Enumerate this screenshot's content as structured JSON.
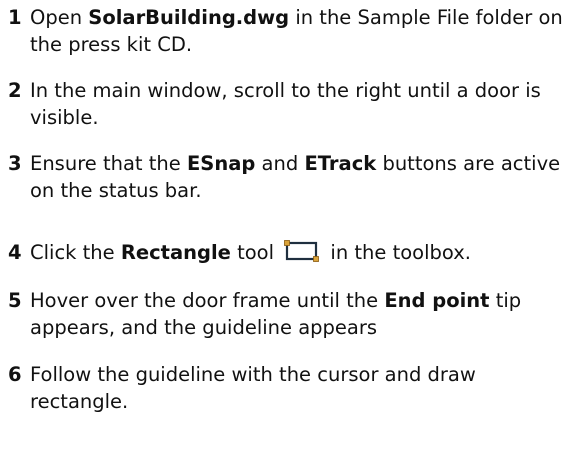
{
  "steps": [
    {
      "number": "1",
      "parts": [
        "Open ",
        "SolarBuilding.dwg",
        " in the Sample File folder on the press kit CD."
      ]
    },
    {
      "number": "2",
      "text": "In the main window, scroll to the right until a door is visible."
    },
    {
      "number": "3",
      "parts": [
        "Ensure that the ",
        "ESnap",
        " and ",
        "ETrack",
        " buttons are active on the status bar."
      ]
    },
    {
      "number": "4",
      "parts": [
        "Click the ",
        "Rectangle",
        " tool ",
        " in the toolbox."
      ],
      "icon": "rectangle-tool-icon"
    },
    {
      "number": "5",
      "parts": [
        "Hover over the door frame until the ",
        "End point",
        " tip appears, and the guideline appears"
      ]
    },
    {
      "number": "6",
      "text": "Follow the guideline with the cursor and draw rectangle."
    }
  ],
  "colors": {
    "text": "#111111",
    "icon_stroke": "#1f2f3f",
    "icon_handles": "#d9a33a"
  }
}
